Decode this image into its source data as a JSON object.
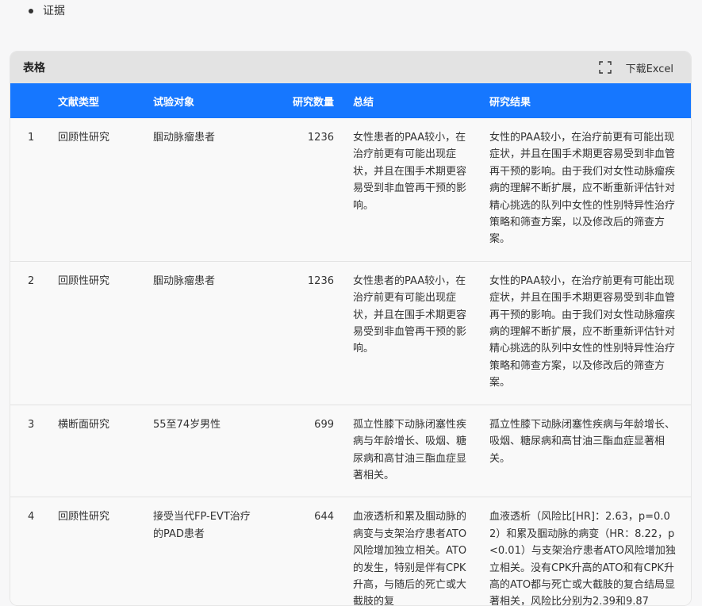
{
  "bullet": {
    "text": "证据"
  },
  "card": {
    "title": "表格",
    "download_label": "下载Excel",
    "fullscreen_icon": "fullscreen-icon"
  },
  "table": {
    "header_color": "#1677ff",
    "columns": [
      "",
      "文献类型",
      "试验对象",
      "研究数量",
      "总结",
      "研究结果"
    ],
    "rows": [
      {
        "index": "1",
        "type": "回顾性研究",
        "subject": "腘动脉瘤患者",
        "count": "1236",
        "summary": "女性患者的PAA较小，在治疗前更有可能出现症状，并且在围手术期更容易受到非血管再干预的影响。",
        "result": "女性的PAA较小，在治疗前更有可能出现症状，并且在围手术期更容易受到非血管再干预的影响。由于我们对女性动脉瘤疾病的理解不断扩展，应不断重新评估针对精心挑选的队列中女性的性别特异性治疗策略和筛查方案，以及修改后的筛查方案。"
      },
      {
        "index": "2",
        "type": "回顾性研究",
        "subject": "腘动脉瘤患者",
        "count": "1236",
        "summary": "女性患者的PAA较小，在治疗前更有可能出现症状，并且在围手术期更容易受到非血管再干预的影响。",
        "result": "女性的PAA较小，在治疗前更有可能出现症状，并且在围手术期更容易受到非血管再干预的影响。由于我们对女性动脉瘤疾病的理解不断扩展，应不断重新评估针对精心挑选的队列中女性的性别特异性治疗策略和筛查方案，以及修改后的筛查方案。"
      },
      {
        "index": "3",
        "type": "横断面研究",
        "subject": "55至74岁男性",
        "count": "699",
        "summary": "孤立性膝下动脉闭塞性疾病与年龄增长、吸烟、糖尿病和高甘油三酯血症显著相关。",
        "result": "孤立性膝下动脉闭塞性疾病与年龄增长、吸烟、糖尿病和高甘油三酯血症显著相关。"
      },
      {
        "index": "4",
        "type": "回顾性研究",
        "subject": "接受当代FP-EVT治疗的PAD患者",
        "count": "644",
        "summary": "血液透析和累及腘动脉的病变与支架治疗患者ATO风险增加独立相关。ATO的发生，特别是伴有CPK升高，与随后的死亡或大截肢的复",
        "result": "血液透析（风险比[HR]：2.63，p=0.02）和累及腘动脉的病变（HR：8.22，p<0.01）与支架治疗患者ATO风险增加独立相关。没有CPK升高的ATO和有CPK升高的ATO都与死亡或大截肢的复合结局显著相关，风险比分别为2.39和9.87"
      }
    ]
  }
}
